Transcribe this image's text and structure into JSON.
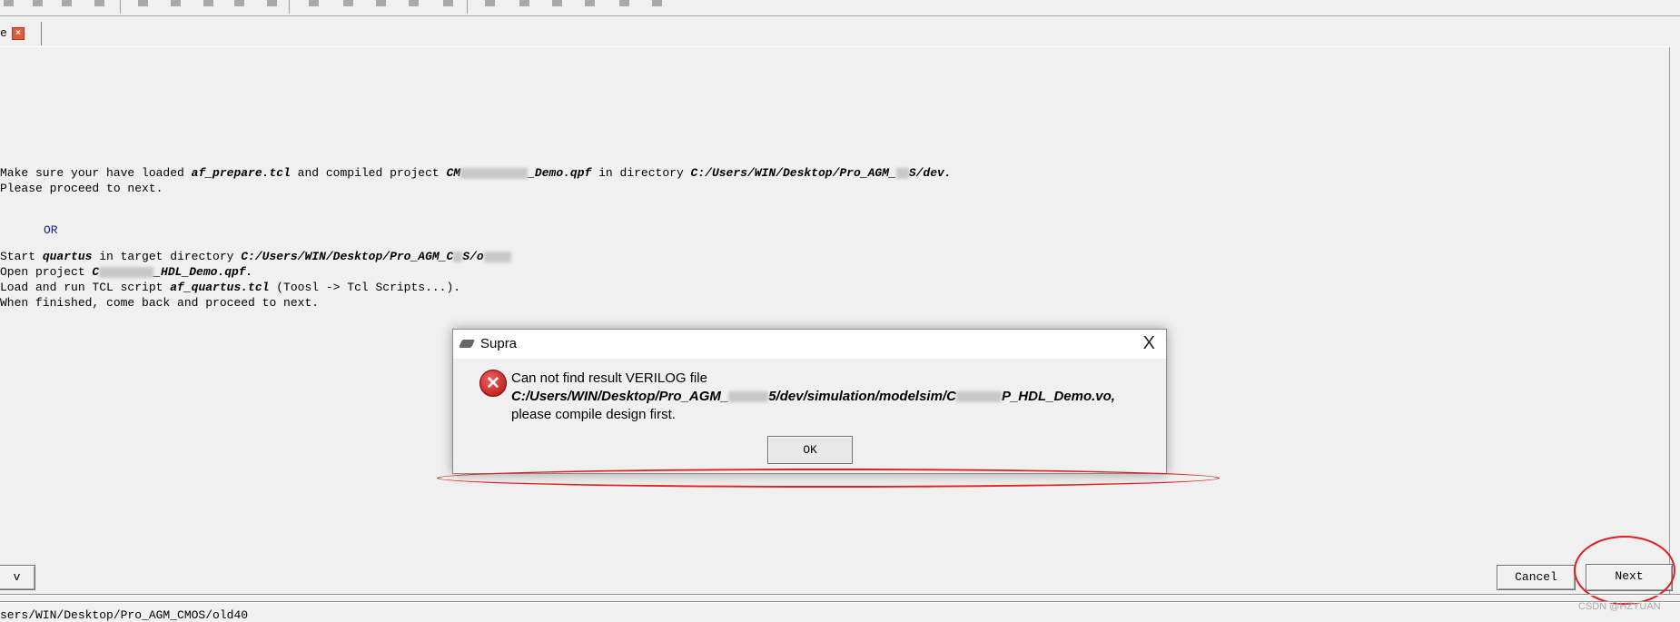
{
  "toolbar": {
    "icons": [
      "new",
      "save",
      "save-as",
      "settings",
      "undo",
      "redo",
      "copy",
      "cut",
      "paste",
      "find",
      "box-a",
      "box-b",
      "box-c",
      "box-d",
      "clock",
      "window",
      "panel",
      "chip",
      "chip2",
      "close-x"
    ]
  },
  "tab": {
    "label": "e",
    "close_icon": "close-icon"
  },
  "content": {
    "line1": {
      "a": "Make sure your have loaded ",
      "b": "af_prepare.tcl",
      "c": " and compiled project ",
      "d": "CM",
      "e": "_Demo.qpf",
      "f": " in directory ",
      "g": "C:/Users/WIN/Desktop/Pro_AGM_",
      "h": "S/dev."
    },
    "line2": "Please proceed to next.",
    "or": "OR",
    "line3": {
      "a": "Start ",
      "b": "quartus",
      "c": " in target directory ",
      "d": "C:/Users/WIN/Desktop/Pro_AGM_C",
      "e": "S/o"
    },
    "line4": {
      "a": "Open project ",
      "b": "C",
      "c": "_HDL_Demo.qpf."
    },
    "line5": {
      "a": "Load and run TCL script ",
      "b": "af_quartus.tcl",
      "c": " (Toosl -> Tcl Scripts...)."
    },
    "line6": "When finished, come back and proceed to next."
  },
  "dialog": {
    "title": "Supra",
    "close": "X",
    "icon": "error-icon",
    "msg1": "Can not find result VERILOG file",
    "path_a": "C:/Users/WIN/Desktop/Pro_AGM_",
    "path_b": "5/dev/simulation/modelsim/C",
    "path_c": "P_HDL_Demo.vo,",
    "msg3": "please compile design first.",
    "ok": "OK"
  },
  "buttons": {
    "prev": "v",
    "cancel": "Cancel",
    "next": "Next"
  },
  "status": "sers/WIN/Desktop/Pro_AGM_CMOS/old40",
  "watermark": "CSDN @HZYUAN",
  "colors": {
    "annotation": "#e02020",
    "error": "#c01818",
    "or_text": "#1a1aa0"
  }
}
